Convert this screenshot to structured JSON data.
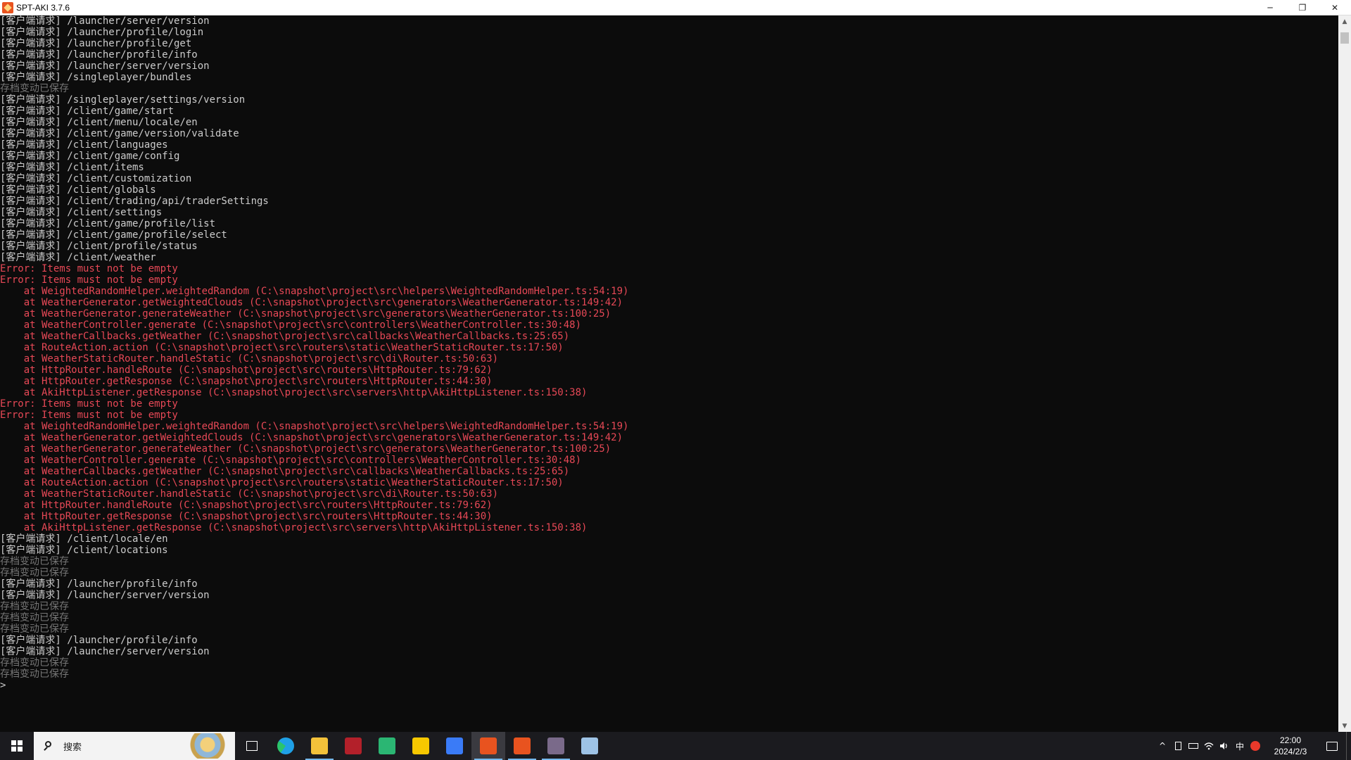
{
  "window": {
    "title": "SPT-AKI 3.7.6",
    "controls": {
      "minimize": "─",
      "restore": "❐",
      "close": "✕"
    }
  },
  "console": {
    "lines": [
      {
        "t": "[客户端请求] /launcher/server/version",
        "k": "req"
      },
      {
        "t": "[客户端请求] /launcher/profile/login",
        "k": "req"
      },
      {
        "t": "[客户端请求] /launcher/profile/get",
        "k": "req"
      },
      {
        "t": "[客户端请求] /launcher/profile/info",
        "k": "req"
      },
      {
        "t": "[客户端请求] /launcher/server/version",
        "k": "req"
      },
      {
        "t": "[客户端请求] /singleplayer/bundles",
        "k": "req"
      },
      {
        "t": "存档变动已保存",
        "k": "save"
      },
      {
        "t": "[客户端请求] /singleplayer/settings/version",
        "k": "req"
      },
      {
        "t": "[客户端请求] /client/game/start",
        "k": "req"
      },
      {
        "t": "[客户端请求] /client/menu/locale/en",
        "k": "req"
      },
      {
        "t": "[客户端请求] /client/game/version/validate",
        "k": "req"
      },
      {
        "t": "[客户端请求] /client/languages",
        "k": "req"
      },
      {
        "t": "[客户端请求] /client/game/config",
        "k": "req"
      },
      {
        "t": "[客户端请求] /client/items",
        "k": "req"
      },
      {
        "t": "[客户端请求] /client/customization",
        "k": "req"
      },
      {
        "t": "[客户端请求] /client/globals",
        "k": "req"
      },
      {
        "t": "[客户端请求] /client/trading/api/traderSettings",
        "k": "req"
      },
      {
        "t": "[客户端请求] /client/settings",
        "k": "req"
      },
      {
        "t": "[客户端请求] /client/game/profile/list",
        "k": "req"
      },
      {
        "t": "[客户端请求] /client/game/profile/select",
        "k": "req"
      },
      {
        "t": "[客户端请求] /client/profile/status",
        "k": "req"
      },
      {
        "t": "[客户端请求] /client/weather",
        "k": "req"
      },
      {
        "t": "Error: Items must not be empty",
        "k": "err"
      },
      {
        "t": "Error: Items must not be empty",
        "k": "err"
      },
      {
        "t": "    at WeightedRandomHelper.weightedRandom (C:\\snapshot\\project\\src\\helpers\\WeightedRandomHelper.ts:54:19)",
        "k": "err"
      },
      {
        "t": "    at WeatherGenerator.getWeightedClouds (C:\\snapshot\\project\\src\\generators\\WeatherGenerator.ts:149:42)",
        "k": "err"
      },
      {
        "t": "    at WeatherGenerator.generateWeather (C:\\snapshot\\project\\src\\generators\\WeatherGenerator.ts:100:25)",
        "k": "err"
      },
      {
        "t": "    at WeatherController.generate (C:\\snapshot\\project\\src\\controllers\\WeatherController.ts:30:48)",
        "k": "err"
      },
      {
        "t": "    at WeatherCallbacks.getWeather (C:\\snapshot\\project\\src\\callbacks\\WeatherCallbacks.ts:25:65)",
        "k": "err"
      },
      {
        "t": "    at RouteAction.action (C:\\snapshot\\project\\src\\routers\\static\\WeatherStaticRouter.ts:17:50)",
        "k": "err"
      },
      {
        "t": "    at WeatherStaticRouter.handleStatic (C:\\snapshot\\project\\src\\di\\Router.ts:50:63)",
        "k": "err"
      },
      {
        "t": "    at HttpRouter.handleRoute (C:\\snapshot\\project\\src\\routers\\HttpRouter.ts:79:62)",
        "k": "err"
      },
      {
        "t": "    at HttpRouter.getResponse (C:\\snapshot\\project\\src\\routers\\HttpRouter.ts:44:30)",
        "k": "err"
      },
      {
        "t": "    at AkiHttpListener.getResponse (C:\\snapshot\\project\\src\\servers\\http\\AkiHttpListener.ts:150:38)",
        "k": "err"
      },
      {
        "t": "Error: Items must not be empty",
        "k": "err"
      },
      {
        "t": "Error: Items must not be empty",
        "k": "err"
      },
      {
        "t": "    at WeightedRandomHelper.weightedRandom (C:\\snapshot\\project\\src\\helpers\\WeightedRandomHelper.ts:54:19)",
        "k": "err"
      },
      {
        "t": "    at WeatherGenerator.getWeightedClouds (C:\\snapshot\\project\\src\\generators\\WeatherGenerator.ts:149:42)",
        "k": "err"
      },
      {
        "t": "    at WeatherGenerator.generateWeather (C:\\snapshot\\project\\src\\generators\\WeatherGenerator.ts:100:25)",
        "k": "err"
      },
      {
        "t": "    at WeatherController.generate (C:\\snapshot\\project\\src\\controllers\\WeatherController.ts:30:48)",
        "k": "err"
      },
      {
        "t": "    at WeatherCallbacks.getWeather (C:\\snapshot\\project\\src\\callbacks\\WeatherCallbacks.ts:25:65)",
        "k": "err"
      },
      {
        "t": "    at RouteAction.action (C:\\snapshot\\project\\src\\routers\\static\\WeatherStaticRouter.ts:17:50)",
        "k": "err"
      },
      {
        "t": "    at WeatherStaticRouter.handleStatic (C:\\snapshot\\project\\src\\di\\Router.ts:50:63)",
        "k": "err"
      },
      {
        "t": "    at HttpRouter.handleRoute (C:\\snapshot\\project\\src\\routers\\HttpRouter.ts:79:62)",
        "k": "err"
      },
      {
        "t": "    at HttpRouter.getResponse (C:\\snapshot\\project\\src\\routers\\HttpRouter.ts:44:30)",
        "k": "err"
      },
      {
        "t": "    at AkiHttpListener.getResponse (C:\\snapshot\\project\\src\\servers\\http\\AkiHttpListener.ts:150:38)",
        "k": "err"
      },
      {
        "t": "[客户端请求] /client/locale/en",
        "k": "req"
      },
      {
        "t": "[客户端请求] /client/locations",
        "k": "req"
      },
      {
        "t": "存档变动已保存",
        "k": "save"
      },
      {
        "t": "存档变动已保存",
        "k": "save"
      },
      {
        "t": "[客户端请求] /launcher/profile/info",
        "k": "req"
      },
      {
        "t": "[客户端请求] /launcher/server/version",
        "k": "req"
      },
      {
        "t": "存档变动已保存",
        "k": "save"
      },
      {
        "t": "存档变动已保存",
        "k": "save"
      },
      {
        "t": "存档变动已保存",
        "k": "save"
      },
      {
        "t": "[客户端请求] /launcher/profile/info",
        "k": "req"
      },
      {
        "t": "[客户端请求] /launcher/server/version",
        "k": "req"
      },
      {
        "t": "存档变动已保存",
        "k": "save"
      },
      {
        "t": "存档变动已保存",
        "k": "save"
      },
      {
        "t": ">",
        "k": "req"
      }
    ]
  },
  "taskbar": {
    "search_placeholder": "搜索",
    "apps": [
      {
        "name": "task-view-icon",
        "color": "#ffffff",
        "active": false,
        "highlight": false
      },
      {
        "name": "edge-icon",
        "color": "#1fa0e6",
        "active": false,
        "highlight": false
      },
      {
        "name": "file-explorer-icon",
        "color": "#f3c13a",
        "active": true,
        "highlight": false
      },
      {
        "name": "game-app-icon",
        "color": "#b3202a",
        "active": false,
        "highlight": false
      },
      {
        "name": "green-app-icon",
        "color": "#2bb673",
        "active": false,
        "highlight": false
      },
      {
        "name": "potplayer-icon",
        "color": "#f7c800",
        "active": false,
        "highlight": false
      },
      {
        "name": "feishu-icon",
        "color": "#3a7bf7",
        "active": false,
        "highlight": false
      },
      {
        "name": "spt-aki-server-icon",
        "color": "#e8531f",
        "active": true,
        "highlight": true
      },
      {
        "name": "spt-aki-launcher-icon",
        "color": "#e8531f",
        "active": true,
        "highlight": false
      },
      {
        "name": "tarkov-game-icon",
        "color": "#7a6a8a",
        "active": true,
        "highlight": false
      },
      {
        "name": "snipping-tool-icon",
        "color": "#9ec3e6",
        "active": false,
        "highlight": false
      }
    ],
    "tray": {
      "chevron": "^",
      "ime": "中",
      "clock_time": "22:00",
      "clock_date": "2024/2/3"
    }
  }
}
